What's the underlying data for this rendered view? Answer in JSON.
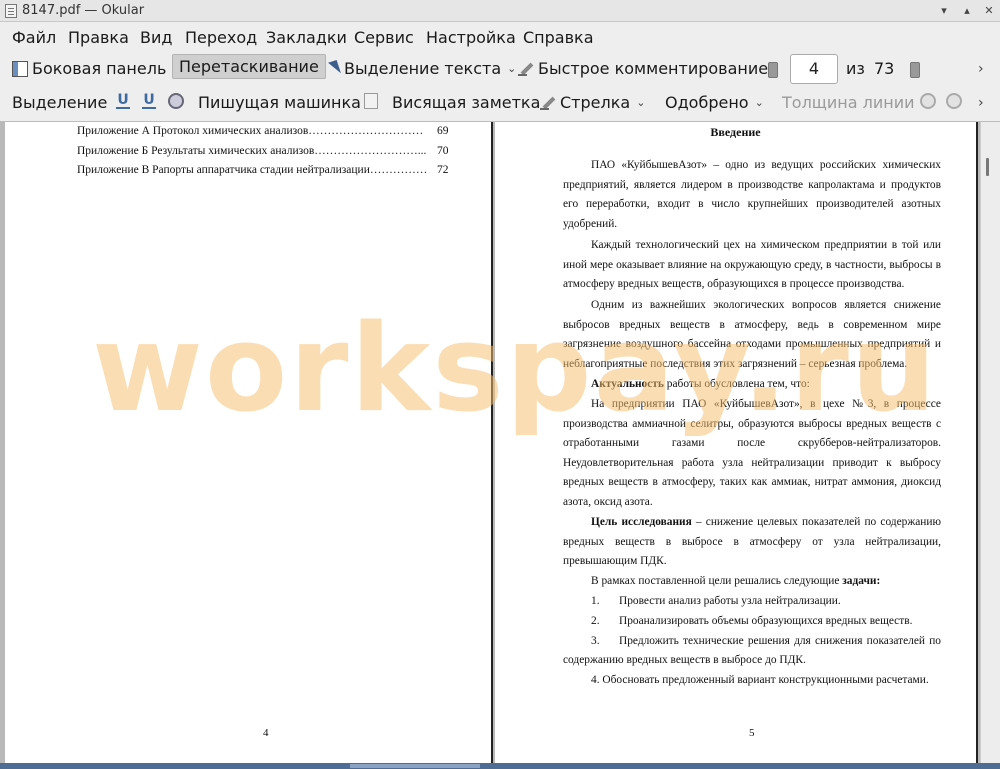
{
  "window": {
    "title": "8147.pdf  — Okular"
  },
  "menu": [
    "Файл",
    "Правка",
    "Вид",
    "Переход",
    "Закладки",
    "Сервис",
    "Настройка",
    "Справка"
  ],
  "toolbar1": {
    "sidebar": "Боковая панель",
    "drag": "Перетаскивание",
    "text_select": "Выделение текста",
    "quick_comment": "Быстрое комментирование",
    "page_current": "4",
    "page_of": "из",
    "page_total": "73",
    "more": "›"
  },
  "toolbar2": {
    "select": "Выделение",
    "typewriter": "Пишущая машинка",
    "note": "Висящая заметка",
    "arrow": "Стрелка",
    "stamp": "Одобрено",
    "line_width": "Толщина линии",
    "more": "›"
  },
  "left_page": {
    "toc": [
      {
        "text": "Приложение А Протокол химических анализов…………………………",
        "page": "69"
      },
      {
        "text": "Приложение Б Результаты химических анализов………………………...",
        "page": "70"
      },
      {
        "text": "Приложение В Рапорты аппаратчика стадии нейтрализации……………",
        "page": "72"
      }
    ],
    "page_number": "4"
  },
  "right_page": {
    "heading": "Введение",
    "p1": "ПАО «КуйбышевАзот» – одно из ведущих российских химических предприятий, является лидером в производстве капролактама и продуктов его переработки, входит в число крупнейших производителей азотных удобрений.",
    "p2": "Каждый технологический цех на химическом предприятии в той или иной мере оказывает влияние на окружающую среду, в частности, выбросы в атмосферу вредных веществ, образующихся в процессе производства.",
    "p3": "Одним из важнейших экологических вопросов является снижение выбросов вредных веществ в атмосферу, ведь в современном мире загрязнение воздушного бассейна отходами промышленных предприятий и неблагоприятные последствия этих загрязнений – серьезная проблема.",
    "p4_bold": "Актуальность",
    "p4_rest": " работы обусловлена тем, что:",
    "p5": "На предприятии ПАО «КуйбышевАзот», в цехе №3, в процессе производства аммиачной селитры, образуются выбросы вредных веществ с отработанными газами после скрубберов-нейтрализаторов. Неудовлетворительная работа узла нейтрализации приводит к выбросу вредных веществ в атмосферу, таких как аммиак, нитрат аммония, диоксид азота, оксид азота.",
    "p6_bold": "Цель исследования",
    "p6_rest": " – снижение целевых показателей по содержанию вредных веществ в выбросе в атмосферу от узла нейтрализации, превышающим ПДК.",
    "p7_start": "В рамках поставленной цели решались следующие ",
    "p7_bold": "задачи:",
    "items": [
      {
        "num": "1.",
        "text": "Провести анализ работы узла нейтрализации."
      },
      {
        "num": "2.",
        "text": "Проанализировать объемы образующихся вредных веществ."
      },
      {
        "num": "3.",
        "text": "Предложить технические решения для снижения показателей по"
      }
    ],
    "p8_cont": "содержанию вредных веществ в выбросе до ПДК.",
    "p9": "4. Обосновать предложенный вариант конструкционными расчетами.",
    "page_number": "5"
  },
  "watermark": "workspay.ru"
}
